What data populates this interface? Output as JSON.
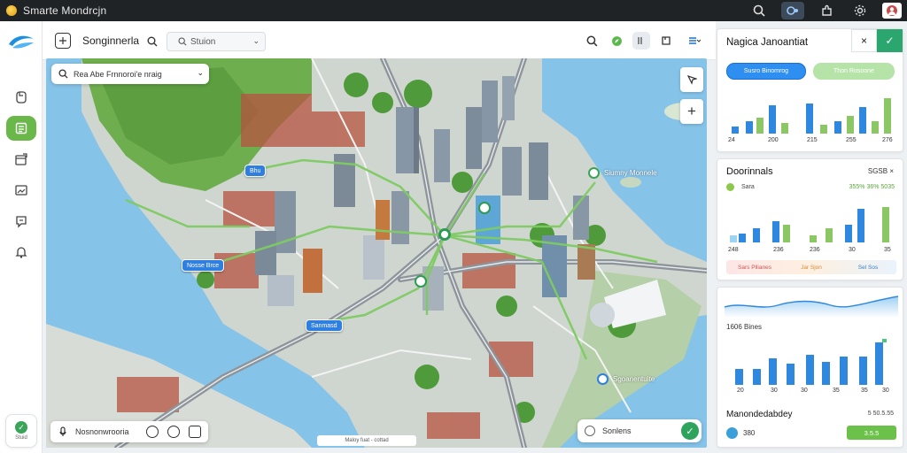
{
  "window": {
    "title": "Smarte Mondrcjn",
    "colors": {
      "titlebar": "#1f2326",
      "accent_green": "#6bb84a",
      "accent_blue": "#2e8ff0"
    }
  },
  "rail": {
    "items": [
      {
        "icon": "document-icon"
      },
      {
        "icon": "list-icon",
        "active": true
      },
      {
        "icon": "calendar-icon"
      },
      {
        "icon": "image-icon"
      },
      {
        "icon": "chat-icon"
      },
      {
        "icon": "bell-icon"
      }
    ],
    "bottom_label": "Stuid"
  },
  "toolbar": {
    "title": "Songinnerla",
    "search_value": "Stuion"
  },
  "map": {
    "search_placeholder": "Rea Abe Frnnoroi'e nraig",
    "pins": [
      "Bhu",
      "Nosse Brce",
      "Sanmasd"
    ],
    "callouts": [
      "Siumny Monnele",
      "Sgoanentuite"
    ],
    "bottom_text": "Nosnonwrooria",
    "scale_text": "Maloy fuat - cottad",
    "route_text": "Sonlens"
  },
  "panel1": {
    "title": "Nagica Janoantiat",
    "pill_blue": "Susro Binomrog",
    "pill_green": "Thon Rosoone",
    "ticks": [
      "24",
      "200",
      "215",
      "255",
      "276"
    ]
  },
  "panel2": {
    "title": "Doorinnals",
    "right_label": "SGSB",
    "legend_label": "Sara",
    "legend_value": "355% 36% 5035",
    "ticks": [
      "248",
      "236",
      "236",
      "30",
      "35"
    ],
    "chips": [
      "Sars Pllianes",
      "Jar Sjon",
      "Sel Sos"
    ]
  },
  "panel3": {
    "kpi_label": "1606 Bines",
    "ticks": [
      "20",
      "30",
      "30",
      "35",
      "35",
      "30"
    ],
    "bottom_title": "Manondedabdey",
    "bottom_right": "5 50.5.55",
    "bottom_row_label": "380",
    "bottom_row_button": "3.5.5"
  }
}
